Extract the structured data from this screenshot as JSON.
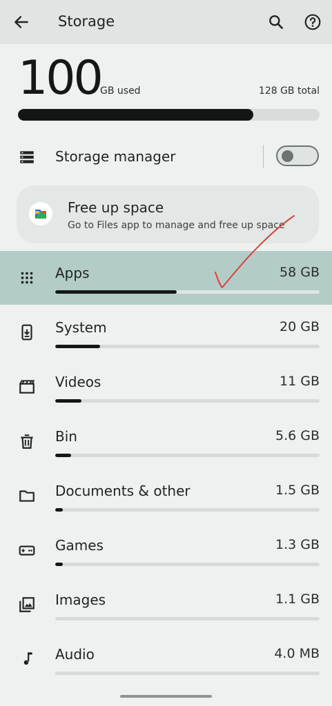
{
  "appbar": {
    "title": "Storage",
    "icons": [
      "back-arrow-icon",
      "search-icon",
      "help-icon"
    ]
  },
  "summary": {
    "used_value": "100",
    "used_unit": "GB used",
    "total": "128 GB total",
    "used_fraction": 0.78
  },
  "storage_manager": {
    "label": "Storage manager",
    "toggle_on": false
  },
  "free_up": {
    "title": "Free up space",
    "subtitle": "Go to Files app to manage and free up space"
  },
  "categories": [
    {
      "label": "Apps",
      "size": "58 GB",
      "fraction": 0.46,
      "icon": "apps-grid-icon",
      "selected": true
    },
    {
      "label": "System",
      "size": "20 GB",
      "fraction": 0.17,
      "icon": "system-phone-icon",
      "selected": false
    },
    {
      "label": "Videos",
      "size": "11 GB",
      "fraction": 0.1,
      "icon": "video-clapper-icon",
      "selected": false
    },
    {
      "label": "Bin",
      "size": "5.6 GB",
      "fraction": 0.06,
      "icon": "trash-icon",
      "selected": false
    },
    {
      "label": "Documents & other",
      "size": "1.5 GB",
      "fraction": 0.03,
      "icon": "folder-icon",
      "selected": false
    },
    {
      "label": "Games",
      "size": "1.3 GB",
      "fraction": 0.03,
      "icon": "gamepad-icon",
      "selected": false
    },
    {
      "label": "Images",
      "size": "1.1 GB",
      "fraction": 0.0,
      "icon": "images-icon",
      "selected": false
    },
    {
      "label": "Audio",
      "size": "4.0 MB",
      "fraction": 0.0,
      "icon": "music-note-icon",
      "selected": false
    }
  ],
  "colors": {
    "background": "#eef1ef",
    "selected_row": "#b4ccc8",
    "bar_fill": "#151717",
    "annotation": "#d9443a"
  }
}
